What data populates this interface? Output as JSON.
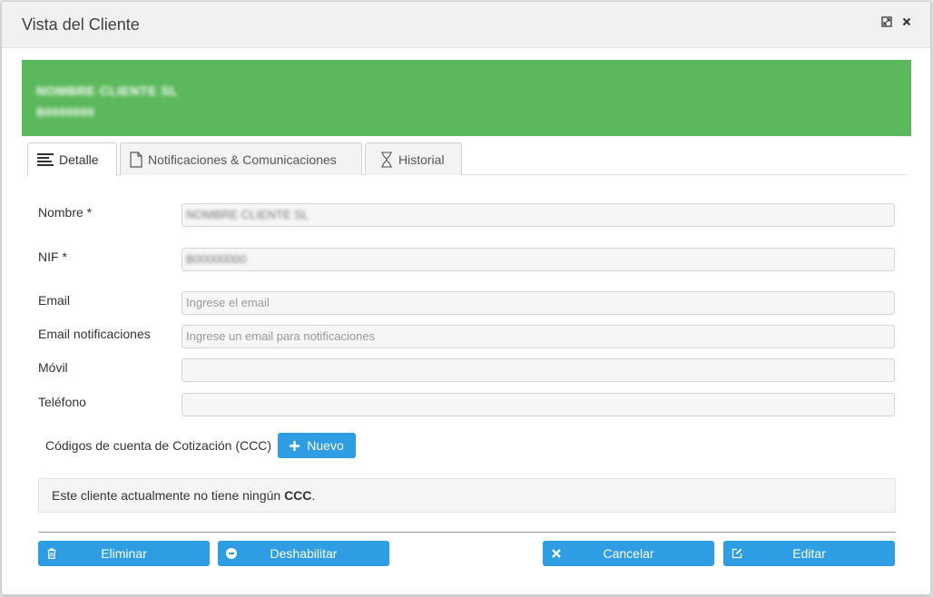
{
  "window": {
    "title": "Vista del Cliente"
  },
  "client_banner": {
    "name": "NOMBRE CLIENTE SL",
    "nif": "B0000000"
  },
  "tabs": [
    {
      "label": "Detalle",
      "icon": "list-icon",
      "active": true
    },
    {
      "label": "Notificaciones & Comunicaciones",
      "icon": "document-icon",
      "active": false
    },
    {
      "label": "Historial",
      "icon": "hourglass-icon",
      "active": false
    }
  ],
  "form": {
    "nombre": {
      "label": "Nombre  *",
      "value": "NOMBRE CLIENTE SL"
    },
    "nif": {
      "label": "NIF *",
      "value": "B00000000"
    },
    "email": {
      "label": "Email",
      "placeholder": "Ingrese el email",
      "value": ""
    },
    "email_notif": {
      "label": "Email notificaciones",
      "placeholder": "Ingrese un email para notificaciones",
      "value": ""
    },
    "movil": {
      "label": "Móvil",
      "value": ""
    },
    "telefono": {
      "label": "Teléfono",
      "value": ""
    }
  },
  "ccc": {
    "label": "Códigos de cuenta de Cotización (CCC)",
    "new_button": "Nuevo",
    "empty_text": "Este cliente actualmente no tiene ningún ",
    "empty_strong": "CCC",
    "empty_end": "."
  },
  "actions": {
    "delete": "Eliminar",
    "disable": "Deshabilitar",
    "cancel": "Cancelar",
    "edit": "Editar"
  },
  "colors": {
    "banner": "#5cb85c",
    "primary_button": "#2e9de3"
  }
}
